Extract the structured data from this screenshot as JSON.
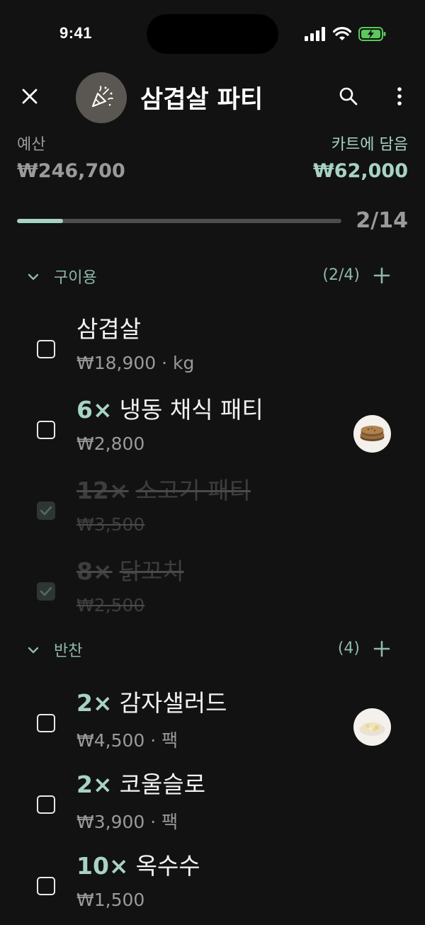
{
  "status_bar": {
    "time": "9:41",
    "icons": [
      "signal-icon",
      "wifi-icon",
      "battery-charging-icon"
    ]
  },
  "header": {
    "title": "삼겹살 파티",
    "icons": {
      "close": "close-icon",
      "avatar": "party-popper-icon",
      "search": "search-icon",
      "more": "more-vertical-icon"
    }
  },
  "summary": {
    "budget_label": "예산",
    "budget_value": "₩246,700",
    "cart_label": "카트에 담음",
    "cart_value": "₩62,000",
    "progress_text": "2/14",
    "progress_fraction": 0.143
  },
  "colors": {
    "accent": "#a7d3c4",
    "background": "#121212",
    "muted": "#9a9a9a"
  },
  "sections": [
    {
      "title": "구이용",
      "count": "(2/4)",
      "items": [
        {
          "qty": "",
          "name": "삼겹살",
          "price": "₩18,900 · kg",
          "checked": false,
          "thumb": ""
        },
        {
          "qty": "6×",
          "name": "냉동 채식 패티",
          "price": "₩2,800",
          "checked": false,
          "thumb": "veggie-patty-icon"
        },
        {
          "qty": "12×",
          "name": "소고기 패티",
          "price": "₩3,500",
          "checked": true,
          "thumb": ""
        },
        {
          "qty": "8×",
          "name": "닭꼬치",
          "price": "₩2,500",
          "checked": true,
          "thumb": ""
        }
      ]
    },
    {
      "title": "반찬",
      "count": "(4)",
      "items": [
        {
          "qty": "2×",
          "name": "감자샐러드",
          "price": "₩4,500 · 팩",
          "checked": false,
          "thumb": "potato-salad-icon"
        },
        {
          "qty": "2×",
          "name": "코울슬로",
          "price": "₩3,900 · 팩",
          "checked": false,
          "thumb": ""
        },
        {
          "qty": "10×",
          "name": "옥수수",
          "price": "₩1,500",
          "checked": false,
          "thumb": ""
        }
      ]
    }
  ]
}
